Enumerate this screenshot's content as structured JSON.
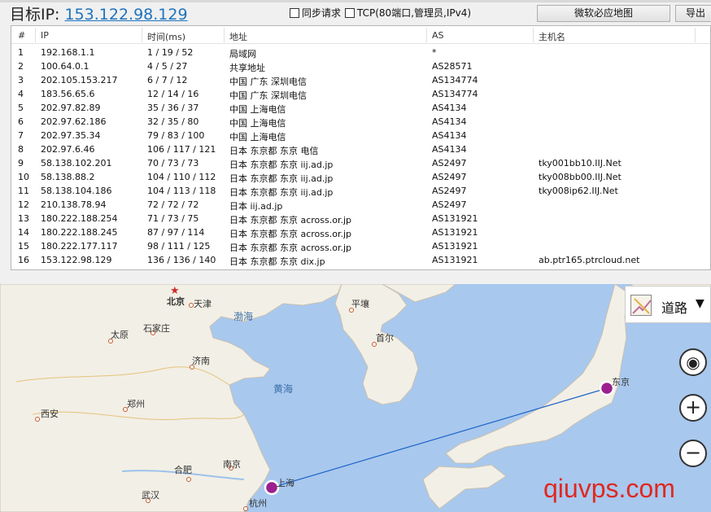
{
  "topbar": {
    "target_label": "目标IP:",
    "target_ip": "153.122.98.129",
    "sync_label": "同步请求",
    "tcp_label": "TCP(80端口,管理员,IPv4)",
    "map_button": "微软必应地图",
    "export_button": "导出"
  },
  "table": {
    "columns": [
      "#",
      "IP",
      "时间(ms)",
      "地址",
      "AS",
      "主机名"
    ],
    "rows": [
      [
        "1",
        "192.168.1.1",
        "1 / 19 / 52",
        "局域网",
        "*",
        ""
      ],
      [
        "2",
        "100.64.0.1",
        "4 / 5 / 27",
        "共享地址",
        "AS28571",
        ""
      ],
      [
        "3",
        "202.105.153.217",
        "6 / 7 / 12",
        "中国 广东 深圳电信",
        "AS134774",
        ""
      ],
      [
        "4",
        "183.56.65.6",
        "12 / 14 / 16",
        "中国 广东 深圳电信",
        "AS134774",
        ""
      ],
      [
        "5",
        "202.97.82.89",
        "35 / 36 / 37",
        "中国 上海电信",
        "AS4134",
        ""
      ],
      [
        "6",
        "202.97.62.186",
        "32 / 35 / 80",
        "中国 上海电信",
        "AS4134",
        ""
      ],
      [
        "7",
        "202.97.35.34",
        "79 / 83 / 100",
        "中国 上海电信",
        "AS4134",
        ""
      ],
      [
        "8",
        "202.97.6.46",
        "106 / 117 / 121",
        "日本 东京都 东京 电信",
        "AS4134",
        ""
      ],
      [
        "9",
        "58.138.102.201",
        "70 / 73 / 73",
        "日本 东京都 东京 iij.ad.jp",
        "AS2497",
        "tky001bb10.IIJ.Net"
      ],
      [
        "10",
        "58.138.88.2",
        "104 / 110 / 112",
        "日本 东京都 东京 iij.ad.jp",
        "AS2497",
        "tky008bb00.IIJ.Net"
      ],
      [
        "11",
        "58.138.104.186",
        "104 / 113 / 118",
        "日本 东京都 东京 iij.ad.jp",
        "AS2497",
        "tky008ip62.IIJ.Net"
      ],
      [
        "12",
        "210.138.78.94",
        "72 / 72 / 72",
        "日本 iij.ad.jp",
        "AS2497",
        ""
      ],
      [
        "13",
        "180.222.188.254",
        "71 / 73 / 75",
        "日本 东京都 东京 across.or.jp",
        "AS131921",
        ""
      ],
      [
        "14",
        "180.222.188.245",
        "87 / 97 / 114",
        "日本 东京都 东京 across.or.jp",
        "AS131921",
        ""
      ],
      [
        "15",
        "180.222.177.117",
        "98 / 111 / 125",
        "日本 东京都 东京 across.or.jp",
        "AS131921",
        ""
      ],
      [
        "16",
        "153.122.98.129",
        "136 / 136 / 140",
        "日本 东京都 东京 dix.jp",
        "AS131921",
        "ab.ptr165.ptrcloud.net"
      ]
    ]
  },
  "map": {
    "road_button_label": "道路",
    "labels": {
      "beijing": "北京",
      "tianjin": "天津",
      "bohai": "渤海",
      "pyongyang": "平壤",
      "taiyuan": "太原",
      "shijiazhuang": "石家庄",
      "seoul": "首尔",
      "jinan": "济南",
      "yellow_sea": "黄海",
      "tokyo": "东京",
      "zhengzhou": "郑州",
      "xian": "西安",
      "hefei": "合肥",
      "nanjing": "南京",
      "shanghai": "上海",
      "wuhan": "武汉",
      "hangzhou": "杭州"
    },
    "colors": {
      "sea": "#a8c8ee",
      "land": "#f2efe6",
      "route": "#1e64c8",
      "marker": "#9b1f8e"
    }
  },
  "watermark": "qiuvps.com"
}
